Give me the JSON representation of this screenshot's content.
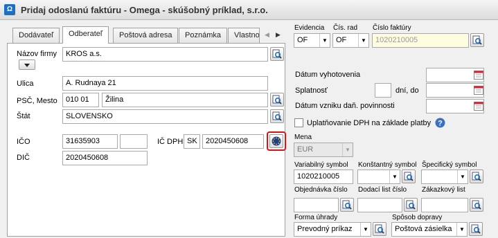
{
  "window": {
    "title": "Pridaj odoslanú faktúru - Omega - skúšobný príklad, s.r.o."
  },
  "tabs": [
    "Dodávateľ",
    "Odberateľ",
    "Poštová adresa",
    "Poznámka",
    "Vlastno"
  ],
  "left": {
    "company_label": "Názov firmy",
    "company_value": "KROS a.s.",
    "street_label": "Ulica",
    "street_value": "A. Rudnaya 21",
    "zip_city_label": "PSČ, Mesto",
    "zip_value": "010 01",
    "city_value": "Žilina",
    "state_label": "Štát",
    "state_value": "SLOVENSKO",
    "ico_label": "IČO",
    "ico_value": "31635903",
    "ico_dph_label": "IČ DPH",
    "ico_dph_prefix": "SK",
    "ico_dph_value": "2020450608",
    "dic_label": "DIČ",
    "dic_value": "2020450608"
  },
  "right": {
    "evidencia_label": "Evidencia",
    "evidencia_value": "OF",
    "cis_rad_label": "Čís. rad",
    "cis_rad_value": "OF",
    "cislo_faktury_label": "Číslo faktúry",
    "cislo_faktury_value": "1020210005",
    "datum_vyhotovenia_label": "Dátum vyhotovenia",
    "splatnost_label": "Splatnosť",
    "dni_do_label": "dní, do",
    "datum_vzniku_label": "Dátum vzniku daň. povinnosti",
    "uplatnovanie_label": "Uplatňovanie DPH na základe platby",
    "mena_label": "Mena",
    "mena_value": "EUR",
    "vs_label": "Variabilný symbol",
    "vs_value": "1020210005",
    "ks_label": "Konštantný symbol",
    "ss_label": "Špecifický symbol",
    "obj_label": "Objednávka číslo",
    "dl_label": "Dodací list číslo",
    "zak_label": "Zákazkový list",
    "forma_label": "Forma úhrady",
    "forma_value": "Prevodný príkaz",
    "sposob_label": "Spôsob dopravy",
    "sposob_value": "Poštová zásielka"
  }
}
